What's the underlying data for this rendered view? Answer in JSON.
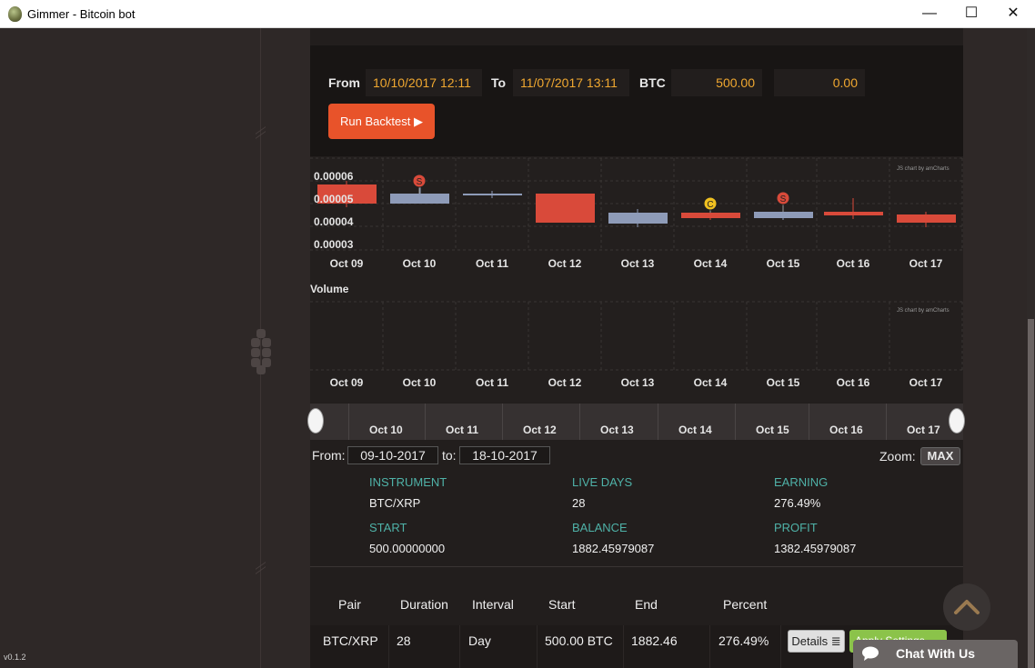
{
  "window": {
    "title": "Gimmer - Bitcoin bot",
    "minimize": "—",
    "maximize": "☐",
    "close": "✕"
  },
  "version": "v0.1.2",
  "backtest_form": {
    "from_label": "From",
    "from_value": "10/10/2017 12:11",
    "to_label": "To",
    "to_value": "11/07/2017 13:11",
    "btc_label": "BTC",
    "btc_value": "500.00",
    "extra_value": "0.00",
    "run_button": "Run Backtest ▶"
  },
  "price_chart": {
    "credit": "JS chart by amCharts",
    "y_ticks": [
      "0.00006",
      "0.00005",
      "0.00004",
      "0.00003"
    ],
    "x_ticks": [
      "Oct 09",
      "Oct 10",
      "Oct 11",
      "Oct 12",
      "Oct 13",
      "Oct 14",
      "Oct 15",
      "Oct 16",
      "Oct 17"
    ],
    "markers": [
      {
        "label": "S",
        "color": "#d94a3a"
      },
      {
        "label": "C",
        "color": "#f0c020"
      },
      {
        "label": "S",
        "color": "#d94a3a"
      }
    ]
  },
  "volume_chart": {
    "title": "Volume",
    "credit": "JS chart by amCharts",
    "x_ticks": [
      "Oct 09",
      "Oct 10",
      "Oct 11",
      "Oct 12",
      "Oct 13",
      "Oct 14",
      "Oct 15",
      "Oct 16",
      "Oct 17"
    ]
  },
  "navigator": {
    "ticks": [
      "Oct 10",
      "Oct 11",
      "Oct 12",
      "Oct 13",
      "Oct 14",
      "Oct 15",
      "Oct 16",
      "Oct 17"
    ]
  },
  "range": {
    "from_label": "From:",
    "from_value": "09-10-2017",
    "to_label": "to:",
    "to_value": "18-10-2017",
    "zoom_label": "Zoom:",
    "zoom_value": "MAX"
  },
  "stats": {
    "instrument_label": "INSTRUMENT",
    "instrument_value": "BTC/XRP",
    "live_days_label": "LIVE DAYS",
    "live_days_value": "28",
    "earning_label": "EARNING",
    "earning_value": "276.49%",
    "start_label": "START",
    "start_value": "500.00000000",
    "balance_label": "BALANCE",
    "balance_value": "1882.45979087",
    "profit_label": "PROFIT",
    "profit_value": "1382.45979087"
  },
  "table": {
    "headers": [
      "Pair",
      "Duration",
      "Interval",
      "Start",
      "End",
      "Percent"
    ],
    "row": [
      "BTC/XRP",
      "28",
      "Day",
      "500.00 BTC",
      "1882.46",
      "276.49%"
    ],
    "details_button": "Details",
    "apply_button": "Apply Settings"
  },
  "chat": {
    "label": "Chat With Us"
  },
  "colors": {
    "accent_orange": "#e8532a",
    "value_orange": "#f0a830",
    "teal_label": "#4fb2a8",
    "bear_candle": "#d94a3a",
    "bull_candle": "#8e9bb8",
    "apply_green": "#8bc34a"
  }
}
